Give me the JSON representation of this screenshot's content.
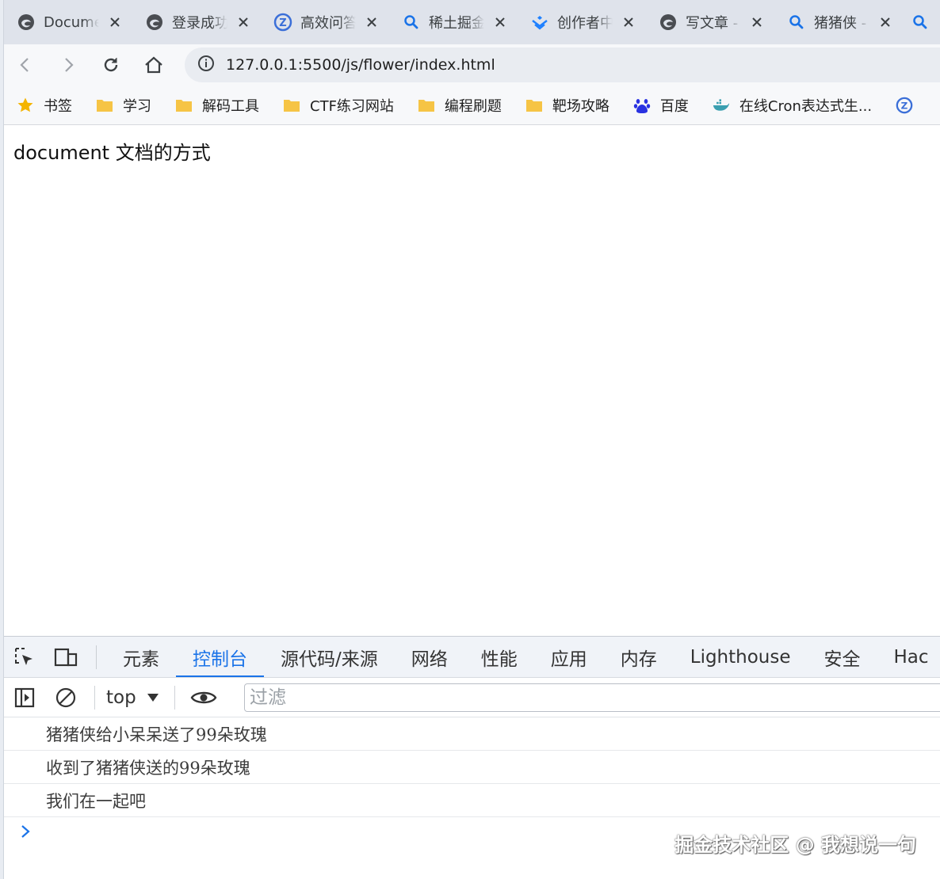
{
  "tabs": [
    {
      "title": "Document",
      "icon": "edge-icon"
    },
    {
      "title": "登录成功",
      "icon": "edge-icon"
    },
    {
      "title": "高效问答",
      "icon": "qa-logo-icon"
    },
    {
      "title": "稀土掘金",
      "icon": "search-icon"
    },
    {
      "title": "创作者中心",
      "icon": "juejin-logo-icon"
    },
    {
      "title": "写文章 - 稀土掘金",
      "icon": "edge-icon"
    },
    {
      "title": "猪猪侠 - 搜索",
      "icon": "search-icon"
    }
  ],
  "address_bar": {
    "url": "127.0.0.1:5500/js/flower/index.html"
  },
  "bookmarks": [
    {
      "label": "书签",
      "icon": "star-icon"
    },
    {
      "label": "学习",
      "icon": "folder-icon"
    },
    {
      "label": "解码工具",
      "icon": "folder-icon"
    },
    {
      "label": "CTF练习网站",
      "icon": "folder-icon"
    },
    {
      "label": "编程刷题",
      "icon": "folder-icon"
    },
    {
      "label": "靶场攻略",
      "icon": "folder-icon"
    },
    {
      "label": "百度",
      "icon": "baidu-paw-icon"
    },
    {
      "label": "在线Cron表达式生...",
      "icon": "docker-whale-icon"
    }
  ],
  "page": {
    "heading": "document 文档的方式"
  },
  "devtools": {
    "tabs": [
      "元素",
      "控制台",
      "源代码/来源",
      "网络",
      "性能",
      "应用",
      "内存",
      "Lighthouse",
      "安全",
      "Hac"
    ],
    "active_tab": "控制台",
    "context": "top",
    "filter_placeholder": "过滤",
    "logs": [
      "猪猪侠给小呆呆送了99朵玫瑰",
      "收到了猪猪侠送的99朵玫瑰",
      "我们在一起吧"
    ]
  },
  "watermark": "掘金技术社区 @ 我想说一句",
  "colors": {
    "accent": "#1a73e8",
    "folder": "#f6c445",
    "star": "#f4b400"
  }
}
